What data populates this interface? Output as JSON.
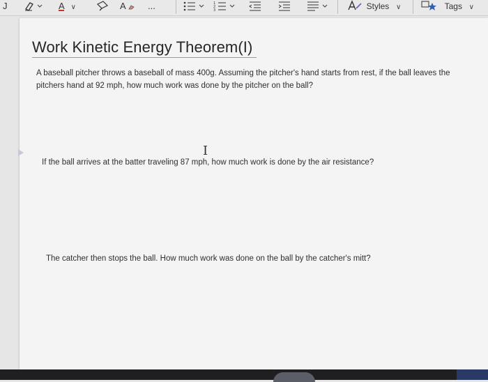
{
  "toolbar": {
    "left_glyph": "J",
    "items": [
      {
        "name": "highlighter-icon"
      },
      {
        "name": "font-color-icon",
        "text": "A"
      },
      {
        "name": "format-painter-icon"
      },
      {
        "name": "clear-formatting-icon",
        "text": "A"
      },
      {
        "name": "more-icon",
        "text": "..."
      },
      {
        "name": "bullets-icon"
      },
      {
        "name": "numbering-icon"
      },
      {
        "name": "decrease-indent-icon"
      },
      {
        "name": "increase-indent-icon"
      },
      {
        "name": "align-icon"
      },
      {
        "name": "styles-icon"
      },
      {
        "name": "tags-icon"
      }
    ],
    "more_label": "...",
    "styles_label": "Styles",
    "tags_label": "Tags",
    "caret": "∨"
  },
  "document": {
    "title": "Work Kinetic Energy Theorem(I)",
    "paragraph1": "A baseball pitcher throws a baseball of mass 400g. Assuming the pitcher's hand starts from rest, if the ball leaves the pitchers hand at 92 mph, how much work was done by the pitcher on the ball?",
    "paragraph2": "If the ball arrives at the batter traveling 87 mph, how much work is done by the air resistance?",
    "paragraph3": "The catcher then stops the ball. How much work was done on the ball by the catcher's mitt?",
    "cursor_glyph": "I"
  }
}
